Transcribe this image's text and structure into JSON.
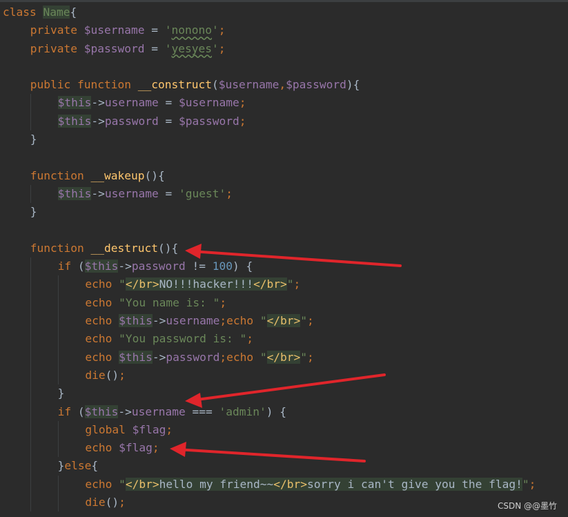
{
  "lines": [
    {
      "indent": 0,
      "tokens": [
        {
          "t": "class ",
          "c": "kw"
        },
        {
          "t": "Name",
          "c": "clsn"
        },
        {
          "t": "{",
          "c": "pl"
        }
      ]
    },
    {
      "indent": 1,
      "tokens": [
        {
          "t": "private ",
          "c": "kw"
        },
        {
          "t": "$username",
          "c": "vr"
        },
        {
          "t": " = ",
          "c": "pl"
        },
        {
          "t": "'",
          "c": "st"
        },
        {
          "t": "nonono",
          "c": "st uw"
        },
        {
          "t": "'",
          "c": "st"
        },
        {
          "t": ";",
          "c": "kw"
        }
      ]
    },
    {
      "indent": 1,
      "tokens": [
        {
          "t": "private ",
          "c": "kw"
        },
        {
          "t": "$password",
          "c": "vr"
        },
        {
          "t": " = ",
          "c": "pl"
        },
        {
          "t": "'",
          "c": "st"
        },
        {
          "t": "yesyes",
          "c": "st uw"
        },
        {
          "t": "'",
          "c": "st"
        },
        {
          "t": ";",
          "c": "kw"
        }
      ]
    },
    {
      "indent": 1,
      "tokens": []
    },
    {
      "indent": 1,
      "tokens": [
        {
          "t": "public ",
          "c": "kw"
        },
        {
          "t": "function ",
          "c": "kw"
        },
        {
          "t": "__construct",
          "c": "fn"
        },
        {
          "t": "(",
          "c": "pl"
        },
        {
          "t": "$username",
          "c": "vr"
        },
        {
          "t": ",",
          "c": "kw"
        },
        {
          "t": "$password",
          "c": "vr"
        },
        {
          "t": "){",
          "c": "pl"
        }
      ]
    },
    {
      "indent": 2,
      "tokens": [
        {
          "t": "$this",
          "c": "vr hl"
        },
        {
          "t": "->",
          "c": "pl"
        },
        {
          "t": "username",
          "c": "vr"
        },
        {
          "t": " = ",
          "c": "pl"
        },
        {
          "t": "$username",
          "c": "vr"
        },
        {
          "t": ";",
          "c": "kw"
        }
      ]
    },
    {
      "indent": 2,
      "tokens": [
        {
          "t": "$this",
          "c": "vr hl"
        },
        {
          "t": "->",
          "c": "pl"
        },
        {
          "t": "password",
          "c": "vr"
        },
        {
          "t": " = ",
          "c": "pl"
        },
        {
          "t": "$password",
          "c": "vr"
        },
        {
          "t": ";",
          "c": "kw"
        }
      ]
    },
    {
      "indent": 1,
      "tokens": [
        {
          "t": "}",
          "c": "pl"
        }
      ]
    },
    {
      "indent": 1,
      "tokens": []
    },
    {
      "indent": 1,
      "tokens": [
        {
          "t": "function ",
          "c": "kw"
        },
        {
          "t": "__wakeup",
          "c": "fn"
        },
        {
          "t": "(){",
          "c": "pl"
        }
      ]
    },
    {
      "indent": 2,
      "tokens": [
        {
          "t": "$this",
          "c": "vr hl"
        },
        {
          "t": "->",
          "c": "pl"
        },
        {
          "t": "username",
          "c": "vr"
        },
        {
          "t": " = ",
          "c": "pl"
        },
        {
          "t": "'guest'",
          "c": "st"
        },
        {
          "t": ";",
          "c": "kw"
        }
      ]
    },
    {
      "indent": 1,
      "tokens": [
        {
          "t": "}",
          "c": "pl"
        }
      ]
    },
    {
      "indent": 1,
      "tokens": []
    },
    {
      "indent": 1,
      "tokens": [
        {
          "t": "function ",
          "c": "kw"
        },
        {
          "t": "__destruct",
          "c": "fn"
        },
        {
          "t": "(){",
          "c": "pl"
        }
      ]
    },
    {
      "indent": 2,
      "tokens": [
        {
          "t": "if ",
          "c": "kw"
        },
        {
          "t": "(",
          "c": "pl"
        },
        {
          "t": "$this",
          "c": "vr hl"
        },
        {
          "t": "->",
          "c": "pl"
        },
        {
          "t": "password",
          "c": "vr"
        },
        {
          "t": " != ",
          "c": "pl"
        },
        {
          "t": "100",
          "c": "nm"
        },
        {
          "t": ") {",
          "c": "pl"
        }
      ]
    },
    {
      "indent": 3,
      "tokens": [
        {
          "t": "echo ",
          "c": "kw"
        },
        {
          "t": "\"",
          "c": "st"
        },
        {
          "t": "</br>",
          "c": "tag hl"
        },
        {
          "t": "NO!!!hacker!!!",
          "c": "pl hl"
        },
        {
          "t": "</br>",
          "c": "tag hl"
        },
        {
          "t": "\"",
          "c": "st"
        },
        {
          "t": ";",
          "c": "kw"
        }
      ]
    },
    {
      "indent": 3,
      "tokens": [
        {
          "t": "echo ",
          "c": "kw"
        },
        {
          "t": "\"You name is: \"",
          "c": "st"
        },
        {
          "t": ";",
          "c": "kw"
        }
      ]
    },
    {
      "indent": 3,
      "tokens": [
        {
          "t": "echo ",
          "c": "kw"
        },
        {
          "t": "$this",
          "c": "vr hl"
        },
        {
          "t": "->",
          "c": "pl"
        },
        {
          "t": "username",
          "c": "vr"
        },
        {
          "t": ";",
          "c": "kw"
        },
        {
          "t": "echo ",
          "c": "kw"
        },
        {
          "t": "\"",
          "c": "st"
        },
        {
          "t": "</br>",
          "c": "tag hl"
        },
        {
          "t": "\"",
          "c": "st"
        },
        {
          "t": ";",
          "c": "kw"
        }
      ]
    },
    {
      "indent": 3,
      "tokens": [
        {
          "t": "echo ",
          "c": "kw"
        },
        {
          "t": "\"You password is: \"",
          "c": "st"
        },
        {
          "t": ";",
          "c": "kw"
        }
      ]
    },
    {
      "indent": 3,
      "tokens": [
        {
          "t": "echo ",
          "c": "kw"
        },
        {
          "t": "$this",
          "c": "vr hl"
        },
        {
          "t": "->",
          "c": "pl"
        },
        {
          "t": "password",
          "c": "vr"
        },
        {
          "t": ";",
          "c": "kw"
        },
        {
          "t": "echo ",
          "c": "kw"
        },
        {
          "t": "\"",
          "c": "st"
        },
        {
          "t": "</br>",
          "c": "tag hl"
        },
        {
          "t": "\"",
          "c": "st"
        },
        {
          "t": ";",
          "c": "kw"
        }
      ]
    },
    {
      "indent": 3,
      "tokens": [
        {
          "t": "die",
          "c": "kw"
        },
        {
          "t": "()",
          "c": "pl"
        },
        {
          "t": ";",
          "c": "kw"
        }
      ]
    },
    {
      "indent": 2,
      "tokens": [
        {
          "t": "}",
          "c": "pl"
        }
      ]
    },
    {
      "indent": 2,
      "tokens": [
        {
          "t": "if ",
          "c": "kw"
        },
        {
          "t": "(",
          "c": "pl"
        },
        {
          "t": "$this",
          "c": "vr hl"
        },
        {
          "t": "->",
          "c": "pl"
        },
        {
          "t": "username",
          "c": "vr"
        },
        {
          "t": " === ",
          "c": "pl"
        },
        {
          "t": "'admin'",
          "c": "st"
        },
        {
          "t": ") {",
          "c": "pl"
        }
      ]
    },
    {
      "indent": 3,
      "tokens": [
        {
          "t": "global ",
          "c": "kw"
        },
        {
          "t": "$flag",
          "c": "vr"
        },
        {
          "t": ";",
          "c": "kw"
        }
      ]
    },
    {
      "indent": 3,
      "tokens": [
        {
          "t": "echo ",
          "c": "kw"
        },
        {
          "t": "$flag",
          "c": "vr"
        },
        {
          "t": ";",
          "c": "kw"
        }
      ]
    },
    {
      "indent": 2,
      "tokens": [
        {
          "t": "}",
          "c": "pl"
        },
        {
          "t": "else",
          "c": "kw"
        },
        {
          "t": "{",
          "c": "pl"
        }
      ]
    },
    {
      "indent": 3,
      "tokens": [
        {
          "t": "echo ",
          "c": "kw"
        },
        {
          "t": "\"",
          "c": "st"
        },
        {
          "t": "</br>",
          "c": "tag hl"
        },
        {
          "t": "hello my friend~~",
          "c": "pl hl"
        },
        {
          "t": "</br>",
          "c": "tag hl"
        },
        {
          "t": "sorry i can't give you the flag!",
          "c": "pl hl"
        },
        {
          "t": "\"",
          "c": "st"
        },
        {
          "t": ";",
          "c": "kw"
        }
      ]
    },
    {
      "indent": 3,
      "tokens": [
        {
          "t": "die",
          "c": "kw"
        },
        {
          "t": "()",
          "c": "pl"
        },
        {
          "t": ";",
          "c": "kw"
        }
      ]
    }
  ],
  "annotation_color": "#e0252b",
  "watermark": "CSDN @@墨竹"
}
